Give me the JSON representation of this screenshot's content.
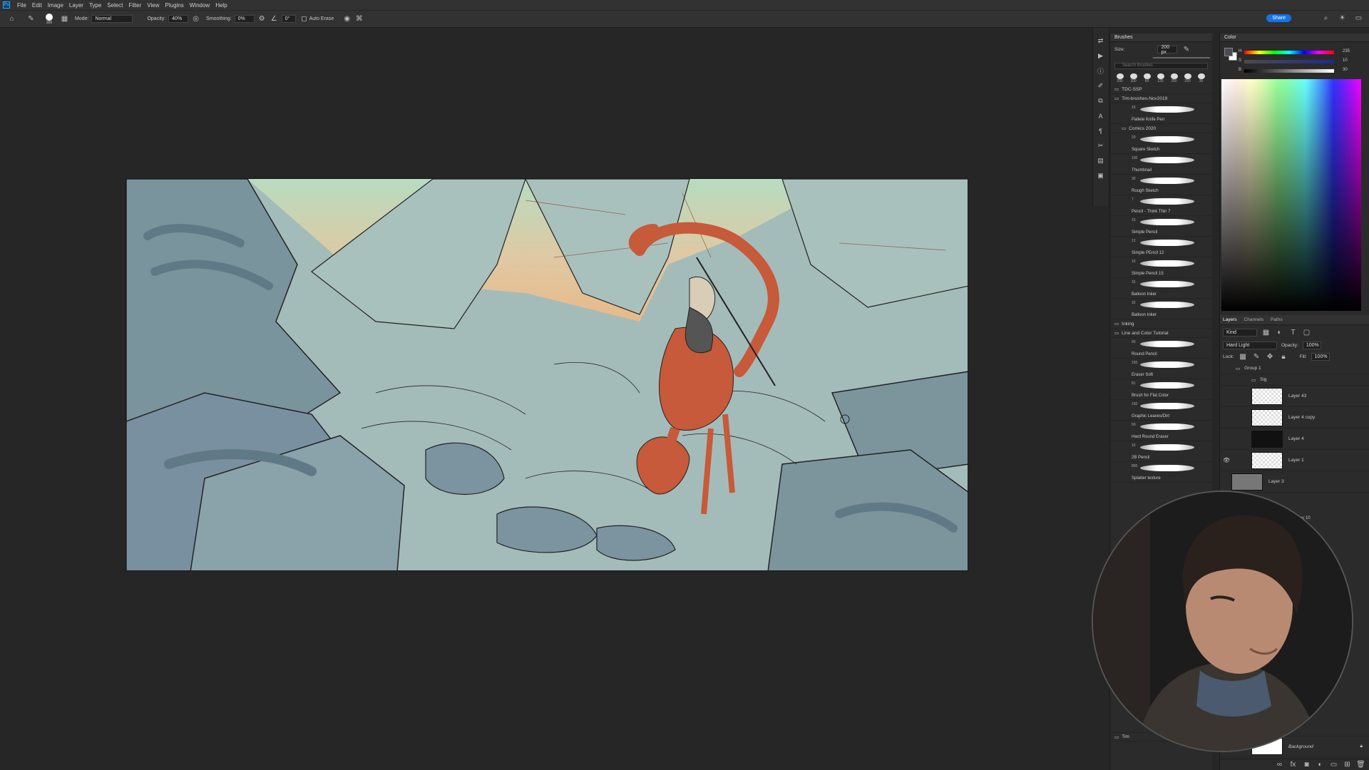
{
  "menubar": {
    "items": [
      "File",
      "Edit",
      "Image",
      "Layer",
      "Type",
      "Select",
      "Filter",
      "View",
      "Plugins",
      "Window",
      "Help"
    ]
  },
  "options": {
    "brush_size": "200",
    "mode_label": "Mode:",
    "mode_value": "Normal",
    "opacity_label": "Opacity:",
    "opacity_value": "40%",
    "smoothing_label": "Smoothing:",
    "smoothing_value": "0%",
    "angle_value": "0°",
    "auto_erase": "Auto Erase",
    "share": "Share"
  },
  "brushes": {
    "title": "Brushes",
    "size_label": "Size:",
    "size_value": "200 px",
    "search_placeholder": "Search Brushes",
    "presets": [
      "200",
      "200",
      "60",
      "125",
      "250",
      "250",
      "30"
    ],
    "folders": [
      {
        "name": "TDC-SSP"
      },
      {
        "name": "Tim-brushes-Nov2019"
      }
    ],
    "top_item": {
      "size": "15",
      "name": "Pallete Knife Pen"
    },
    "subfolder": "Comics 2020",
    "items": [
      {
        "size": "20",
        "name": "Square Sketch"
      },
      {
        "size": "100",
        "name": "Thumbnail"
      },
      {
        "size": "30",
        "name": "Rough Sketch"
      },
      {
        "size": "7",
        "name": "Pencil - Think Thin 7"
      },
      {
        "size": "15",
        "name": "Simple Pencil"
      },
      {
        "size": "12",
        "name": "Simple PEncil 12"
      },
      {
        "size": "15",
        "name": "Simple Pencil 15"
      },
      {
        "size": "15",
        "name": "Balloon Inker"
      },
      {
        "size": "15",
        "name": "Balloon Inker"
      }
    ],
    "folder2": "Inking",
    "folder3": "Line and Color Tutorial",
    "items2": [
      {
        "size": "60",
        "name": "Round Pencil"
      },
      {
        "size": "150",
        "name": "Eraser Soft"
      },
      {
        "size": "81",
        "name": "Brush for Flat Color"
      },
      {
        "size": "150",
        "name": "Graphic Leaves/Dirt"
      },
      {
        "size": "60",
        "name": "Hard Round Eraser"
      },
      {
        "size": "15",
        "name": "2B Pencil"
      },
      {
        "size": "800",
        "name": "Splatter texture"
      }
    ],
    "bottom_folder": "Tim"
  },
  "color": {
    "title": "Color",
    "h_label": "H",
    "s_label": "S",
    "b_label": "B",
    "h_value": "235",
    "s_value": "10",
    "b_value": "30",
    "fg": "#4a4c52",
    "bg": "#ffffff"
  },
  "layers": {
    "tabs": [
      "Layers",
      "Channels",
      "Paths"
    ],
    "kind_label": "Kind",
    "blend": "Hard Light",
    "opacity_label": "Opacity:",
    "opacity_value": "100%",
    "lock_label": "Lock:",
    "fill_label": "Fill:",
    "fill_value": "100%",
    "rows": [
      "Group 1",
      "Sig",
      "Layer 43",
      "Layer 4 copy",
      "Layer 4",
      "Layer 1",
      "Layer 3"
    ],
    "partial": "ov 10",
    "background": "Background"
  }
}
